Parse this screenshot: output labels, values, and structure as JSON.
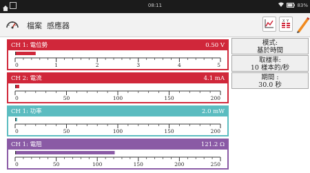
{
  "status_bar": {
    "time": "08:11",
    "battery": "83%",
    "icons": [
      "home-icon",
      "image-icon",
      "wifi-icon",
      "battery-icon"
    ]
  },
  "toolbar": {
    "menu_file": "檔案",
    "menu_sensors": "感應器",
    "icons": [
      "gauge-icon",
      "graph-icon",
      "table-icon",
      "pencil-icon"
    ]
  },
  "channels": [
    {
      "label": "CH 1: 電位勢",
      "value": "0.50 V",
      "color": "#d0273a",
      "ticks": [
        "0",
        "1",
        "2",
        "3",
        "4",
        "5"
      ],
      "level": 0.1
    },
    {
      "label": "CH 2: 電流",
      "value": "4.1 mA",
      "color": "#d0273a",
      "ticks": [
        "0",
        "50",
        "100",
        "150",
        "200"
      ],
      "level": 0.02
    },
    {
      "label": "CH 1: 功率",
      "value": "2.0 mW",
      "color": "#5bbcc0",
      "ticks": [
        "0",
        "50",
        "100",
        "150",
        "200"
      ],
      "level": 0.01
    },
    {
      "label": "CH 1: 電阻",
      "value": "121.2 Ω",
      "color": "#8a5aa5",
      "ticks": [
        "0",
        "50",
        "100",
        "150",
        "200",
        "250"
      ],
      "level": 0.485
    }
  ],
  "panel": {
    "mode_label": "模式:",
    "mode_value": "基於時間",
    "rate_label": "取樣率:",
    "rate_value": "10 樣本的/秒",
    "period_label": "期間 :",
    "period_value": "30.0 秒"
  }
}
